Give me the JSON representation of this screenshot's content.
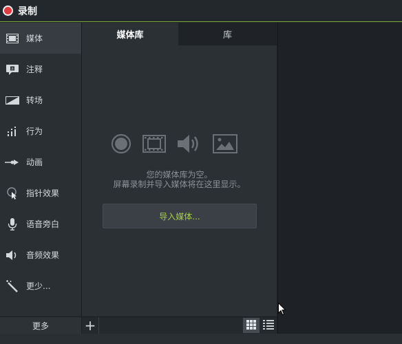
{
  "toolbar": {
    "record_label": "录制"
  },
  "sidebar": {
    "items": [
      {
        "label": "媒体",
        "icon": "film-icon",
        "active": true
      },
      {
        "label": "注释",
        "icon": "callout-icon"
      },
      {
        "label": "转场",
        "icon": "transition-icon"
      },
      {
        "label": "行为",
        "icon": "behavior-icon"
      },
      {
        "label": "动画",
        "icon": "animation-icon"
      },
      {
        "label": "指针效果",
        "icon": "cursor-effect-icon"
      },
      {
        "label": "语音旁白",
        "icon": "microphone-icon"
      },
      {
        "label": "音频效果",
        "icon": "speaker-icon"
      },
      {
        "label": "更少...",
        "icon": "magic-wand-icon"
      }
    ],
    "more_label": "更多"
  },
  "media_panel": {
    "tabs": [
      {
        "label": "媒体库",
        "active": true
      },
      {
        "label": "库"
      }
    ],
    "empty_line1": "您的媒体库为空。",
    "empty_line2": "屏幕录制并导入媒体将在这里显示。",
    "import_label": "导入媒体...",
    "add_label": "+"
  },
  "colors": {
    "accent_green": "#a6cc4b",
    "record_red": "#e13b3f",
    "toolbar_line": "#7fae3a"
  }
}
